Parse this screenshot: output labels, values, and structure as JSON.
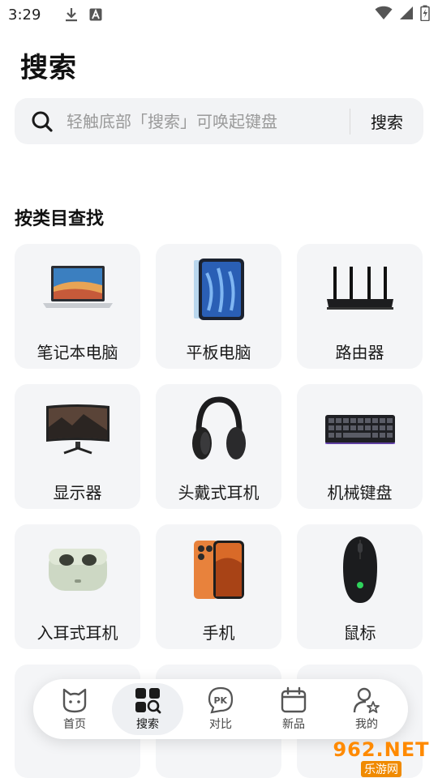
{
  "status_bar": {
    "time": "3:29",
    "icons_left": [
      "download-icon",
      "a-badge-icon"
    ],
    "icons_right": [
      "wifi-icon",
      "signal-icon",
      "battery-icon"
    ]
  },
  "page": {
    "title": "搜索"
  },
  "search": {
    "placeholder": "轻触底部「搜索」可唤起键盘",
    "button_label": "搜索"
  },
  "categories_section": {
    "title": "按类目查找",
    "items": [
      {
        "label": "笔记本电脑",
        "icon": "laptop-icon"
      },
      {
        "label": "平板电脑",
        "icon": "tablet-icon"
      },
      {
        "label": "路由器",
        "icon": "router-icon"
      },
      {
        "label": "显示器",
        "icon": "monitor-icon"
      },
      {
        "label": "头戴式耳机",
        "icon": "headphones-icon"
      },
      {
        "label": "机械键盘",
        "icon": "keyboard-icon"
      },
      {
        "label": "入耳式耳机",
        "icon": "earbuds-icon"
      },
      {
        "label": "手机",
        "icon": "phone-icon"
      },
      {
        "label": "鼠标",
        "icon": "mouse-icon"
      }
    ]
  },
  "tabbar": {
    "tabs": [
      {
        "label": "首页",
        "icon": "cat-home-icon",
        "active": false
      },
      {
        "label": "搜索",
        "icon": "search-grid-icon",
        "active": true
      },
      {
        "label": "对比",
        "icon": "pk-icon",
        "active": false
      },
      {
        "label": "新品",
        "icon": "calendar-icon",
        "active": false
      },
      {
        "label": "我的",
        "icon": "profile-star-icon",
        "active": false
      }
    ]
  },
  "watermark": {
    "top": "962.NET",
    "bottom": "乐游网"
  },
  "colors": {
    "card_bg": "#f4f5f7",
    "search_bg": "#f2f3f5",
    "watermark": "#ff8a00"
  }
}
